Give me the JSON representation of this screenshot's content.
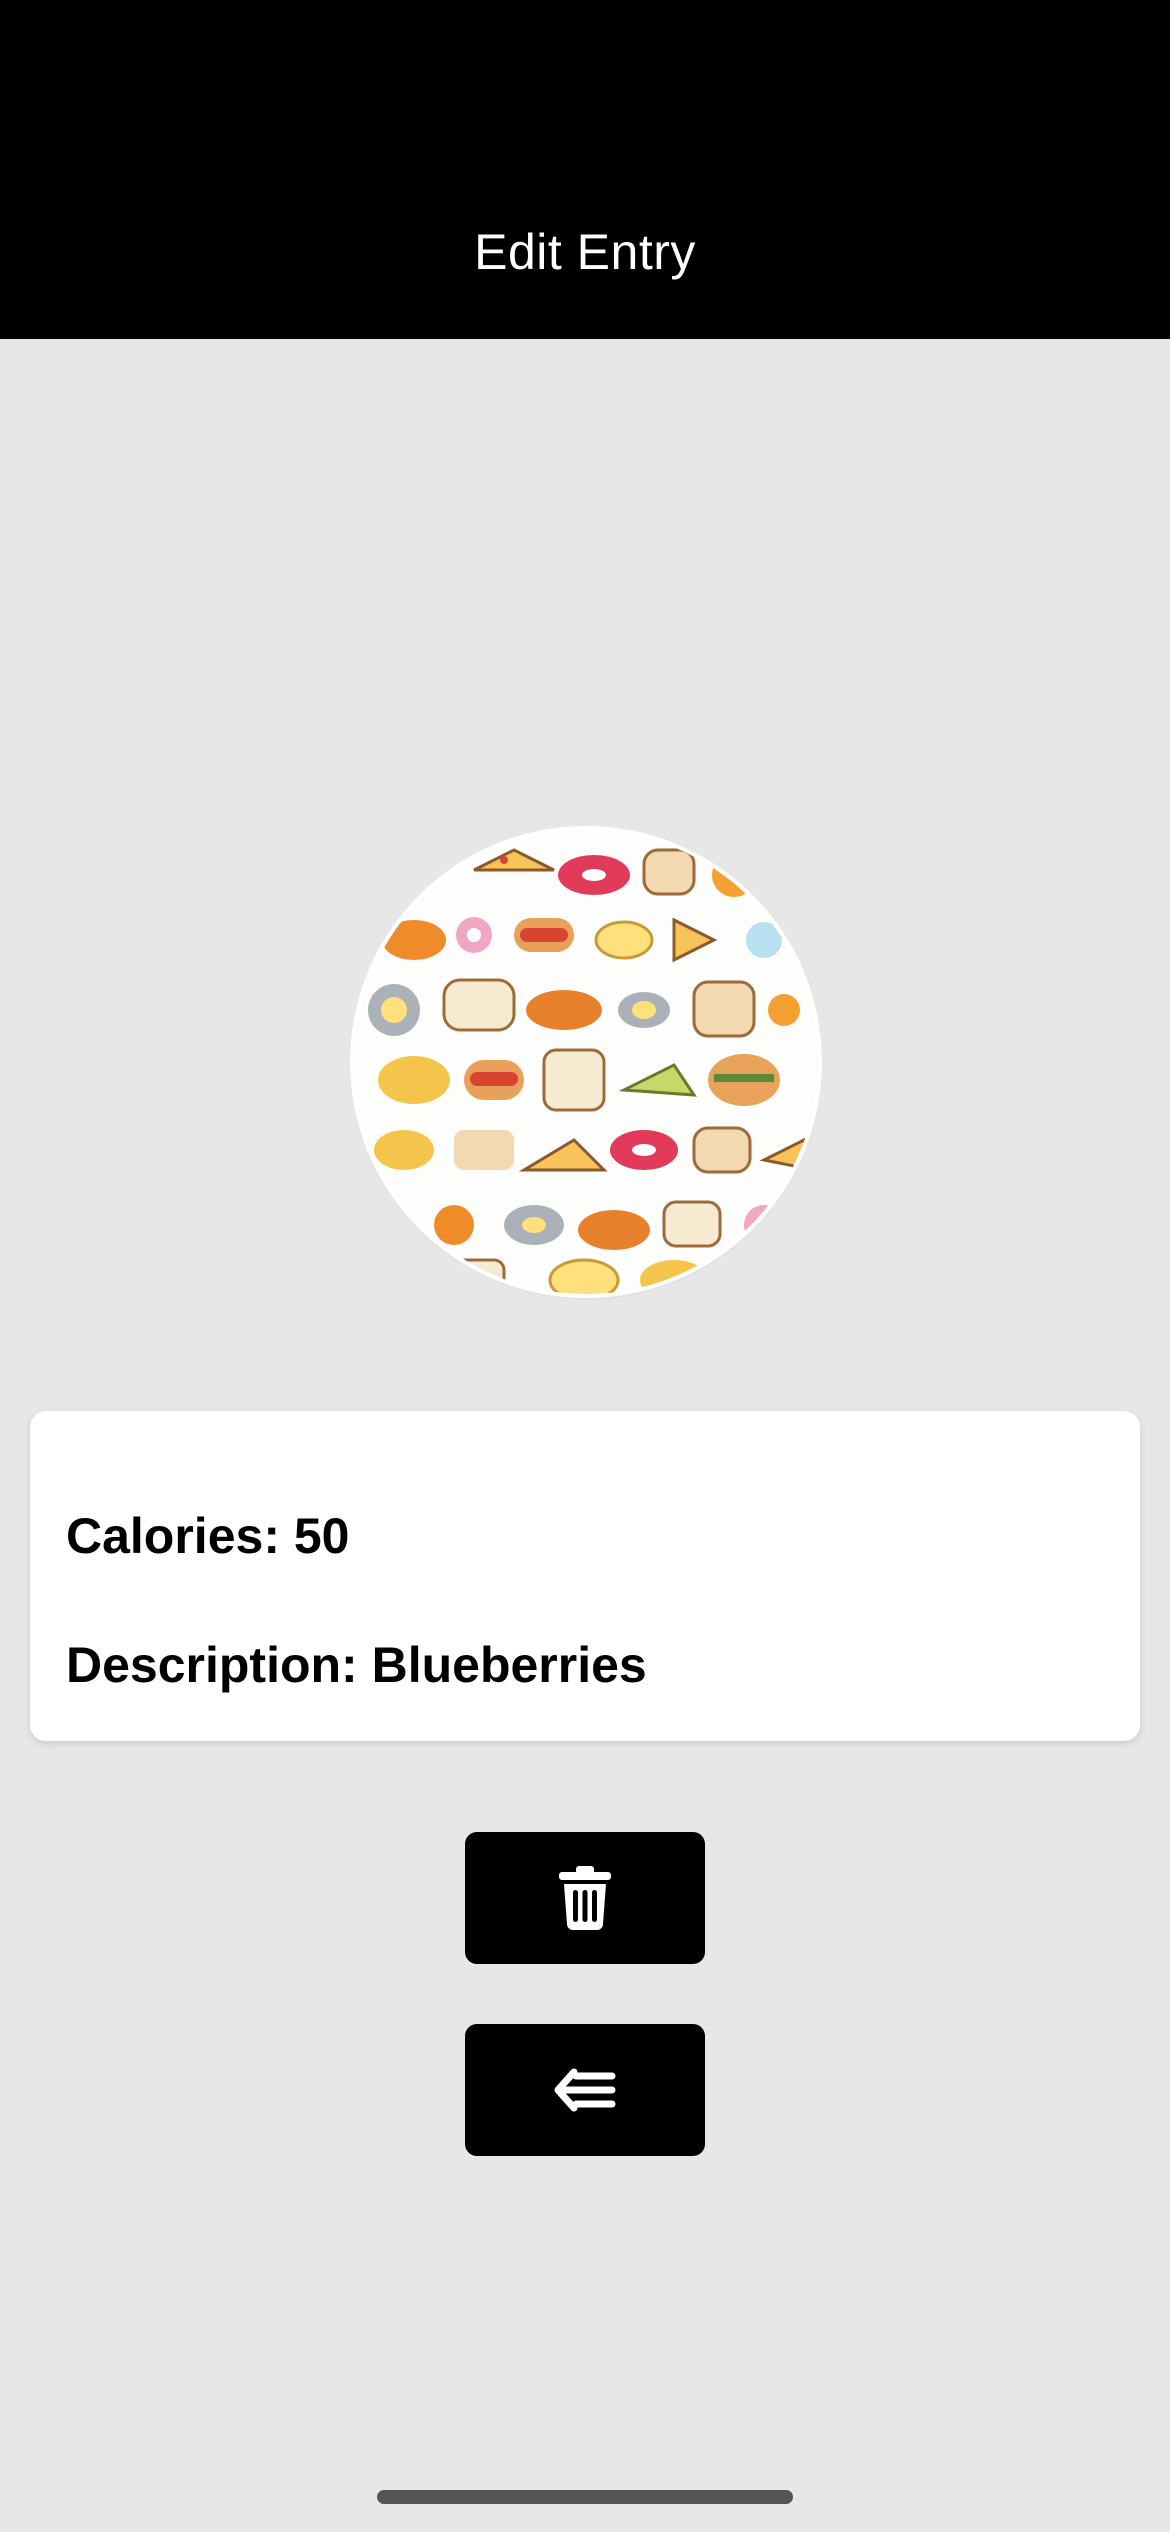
{
  "header": {
    "title": "Edit Entry"
  },
  "entry": {
    "image_icon": "food-pattern-image",
    "calories_label": "Calories: 50",
    "description_label": "Description: Blueberries"
  },
  "actions": {
    "delete_icon": "trash-icon",
    "back_icon": "arrow-left-list-icon"
  },
  "colors": {
    "header_bg": "#000000",
    "page_bg": "#e7e7e7",
    "card_bg": "#ffffff",
    "button_bg": "#000000",
    "button_icon": "#ffffff"
  }
}
